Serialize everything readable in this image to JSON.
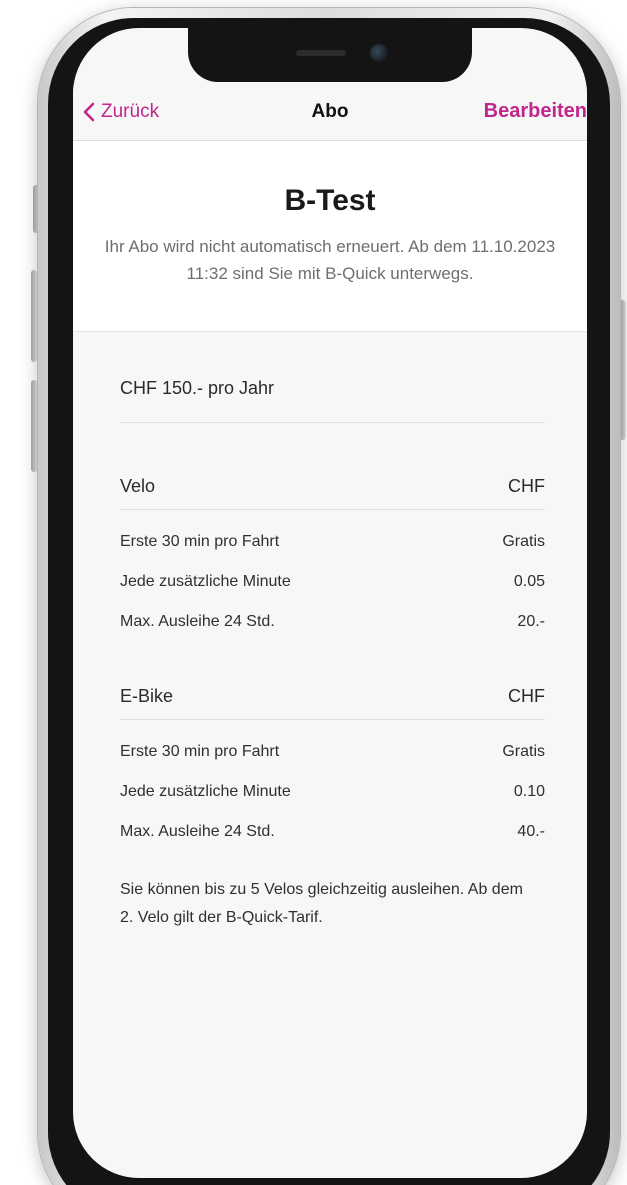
{
  "nav": {
    "back_label": "Zurück",
    "title": "Abo",
    "edit_label": "Bearbeiten"
  },
  "header": {
    "title": "B-Test",
    "description": "Ihr Abo wird nicht automatisch erneuert. Ab dem 11.10.2023 11:32 sind Sie mit B-Quick unterwegs."
  },
  "price": "CHF 150.- pro Jahr",
  "sections": [
    {
      "name": "Velo",
      "currency": "CHF",
      "rows": [
        {
          "label": "Erste 30 min pro Fahrt",
          "value": "Gratis"
        },
        {
          "label": "Jede zusätzliche Minute",
          "value": "0.05"
        },
        {
          "label": "Max. Ausleihe 24 Std.",
          "value": "20.-"
        }
      ]
    },
    {
      "name": "E-Bike",
      "currency": "CHF",
      "rows": [
        {
          "label": "Erste 30 min pro Fahrt",
          "value": "Gratis"
        },
        {
          "label": "Jede zusätzliche Minute",
          "value": "0.10"
        },
        {
          "label": "Max. Ausleihe 24 Std.",
          "value": "40.-"
        }
      ]
    }
  ],
  "note": "Sie können bis zu 5 Velos gleichzeitig ausleihen. Ab dem 2. Velo gilt der B-Quick-Tarif.",
  "colors": {
    "accent": "#c0268c",
    "background": "#f7f7f7"
  },
  "icons": {
    "back": "chevron-left-icon"
  }
}
